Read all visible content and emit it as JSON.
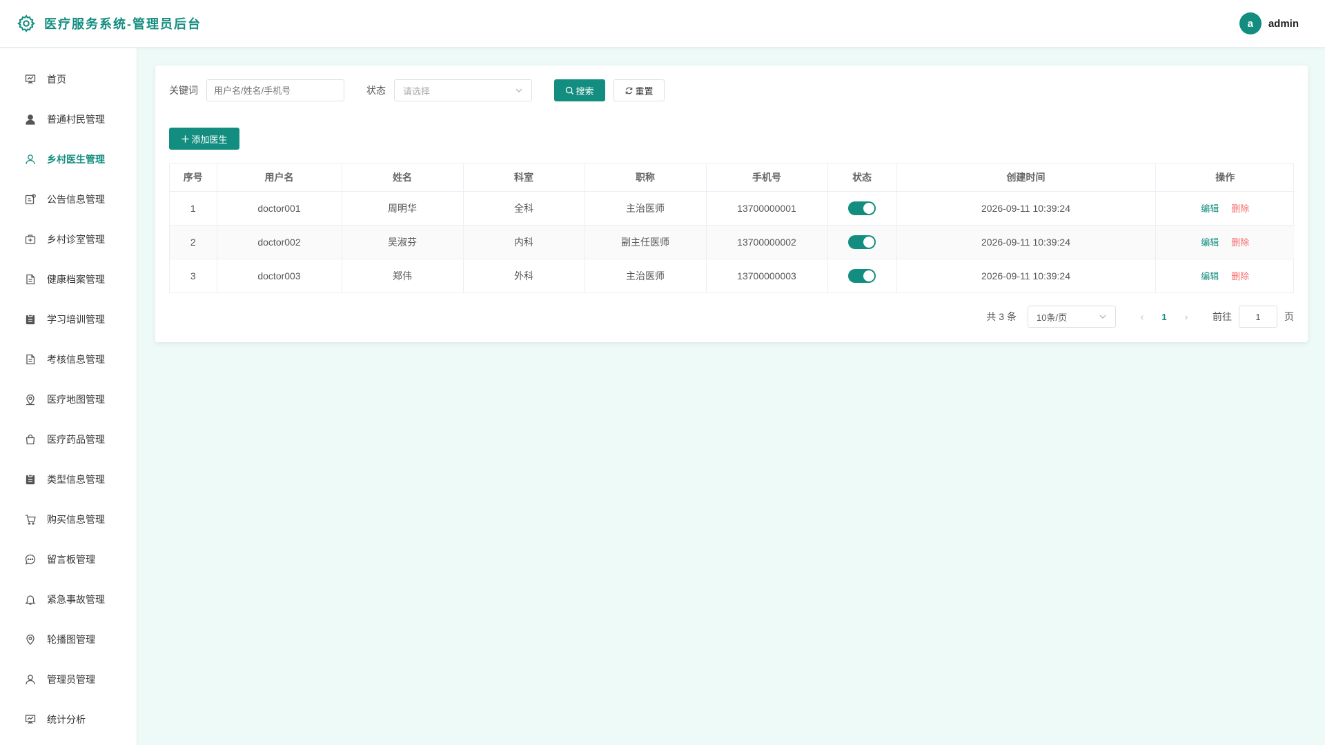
{
  "header": {
    "title": "医疗服务系统-管理员后台",
    "avatar_letter": "a",
    "username": "admin"
  },
  "sidebar": {
    "items": [
      {
        "label": "首页",
        "icon": "dashboard-icon"
      },
      {
        "label": "普通村民管理",
        "icon": "user-filled-icon"
      },
      {
        "label": "乡村医生管理",
        "icon": "user-icon",
        "active": true
      },
      {
        "label": "公告信息管理",
        "icon": "notice-icon"
      },
      {
        "label": "乡村诊室管理",
        "icon": "first-aid-kit-icon"
      },
      {
        "label": "健康档案管理",
        "icon": "document-icon"
      },
      {
        "label": "学习培训管理",
        "icon": "clipboard-icon"
      },
      {
        "label": "考核信息管理",
        "icon": "document-icon"
      },
      {
        "label": "医疗地图管理",
        "icon": "location-icon"
      },
      {
        "label": "医疗药品管理",
        "icon": "shopping-bag-icon"
      },
      {
        "label": "类型信息管理",
        "icon": "clipboard-icon"
      },
      {
        "label": "购买信息管理",
        "icon": "cart-icon"
      },
      {
        "label": "留言板管理",
        "icon": "chat-icon"
      },
      {
        "label": "紧急事故管理",
        "icon": "bell-icon"
      },
      {
        "label": "轮播图管理",
        "icon": "pin-icon"
      },
      {
        "label": "管理员管理",
        "icon": "user-icon"
      },
      {
        "label": "统计分析",
        "icon": "dashboard-icon"
      }
    ]
  },
  "filters": {
    "keyword_label": "关键词",
    "keyword_placeholder": "用户名/姓名/手机号",
    "status_label": "状态",
    "status_placeholder": "请选择",
    "search_label": "搜索",
    "reset_label": "重置"
  },
  "add_button_label": "添加医生",
  "table": {
    "headers": [
      "序号",
      "用户名",
      "姓名",
      "科室",
      "职称",
      "手机号",
      "状态",
      "创建时间",
      "操作"
    ],
    "edit_label": "编辑",
    "delete_label": "删除",
    "rows": [
      {
        "index": "1",
        "username": "doctor001",
        "name": "周明华",
        "department": "全科",
        "title": "主治医师",
        "phone": "13700000001",
        "enabled": true,
        "created": "2026-09-11 10:39:24"
      },
      {
        "index": "2",
        "username": "doctor002",
        "name": "吴淑芬",
        "department": "内科",
        "title": "副主任医师",
        "phone": "13700000002",
        "enabled": true,
        "created": "2026-09-11 10:39:24"
      },
      {
        "index": "3",
        "username": "doctor003",
        "name": "郑伟",
        "department": "外科",
        "title": "主治医师",
        "phone": "13700000003",
        "enabled": true,
        "created": "2026-09-11 10:39:24"
      }
    ]
  },
  "pagination": {
    "total_text": "共 3 条",
    "page_size": "10条/页",
    "current_page": "1",
    "goto_label": "前往",
    "goto_value": "1",
    "page_suffix": "页"
  },
  "colors": {
    "accent": "#138d7f",
    "danger": "#f56c6c",
    "background": "#eefaf8"
  }
}
